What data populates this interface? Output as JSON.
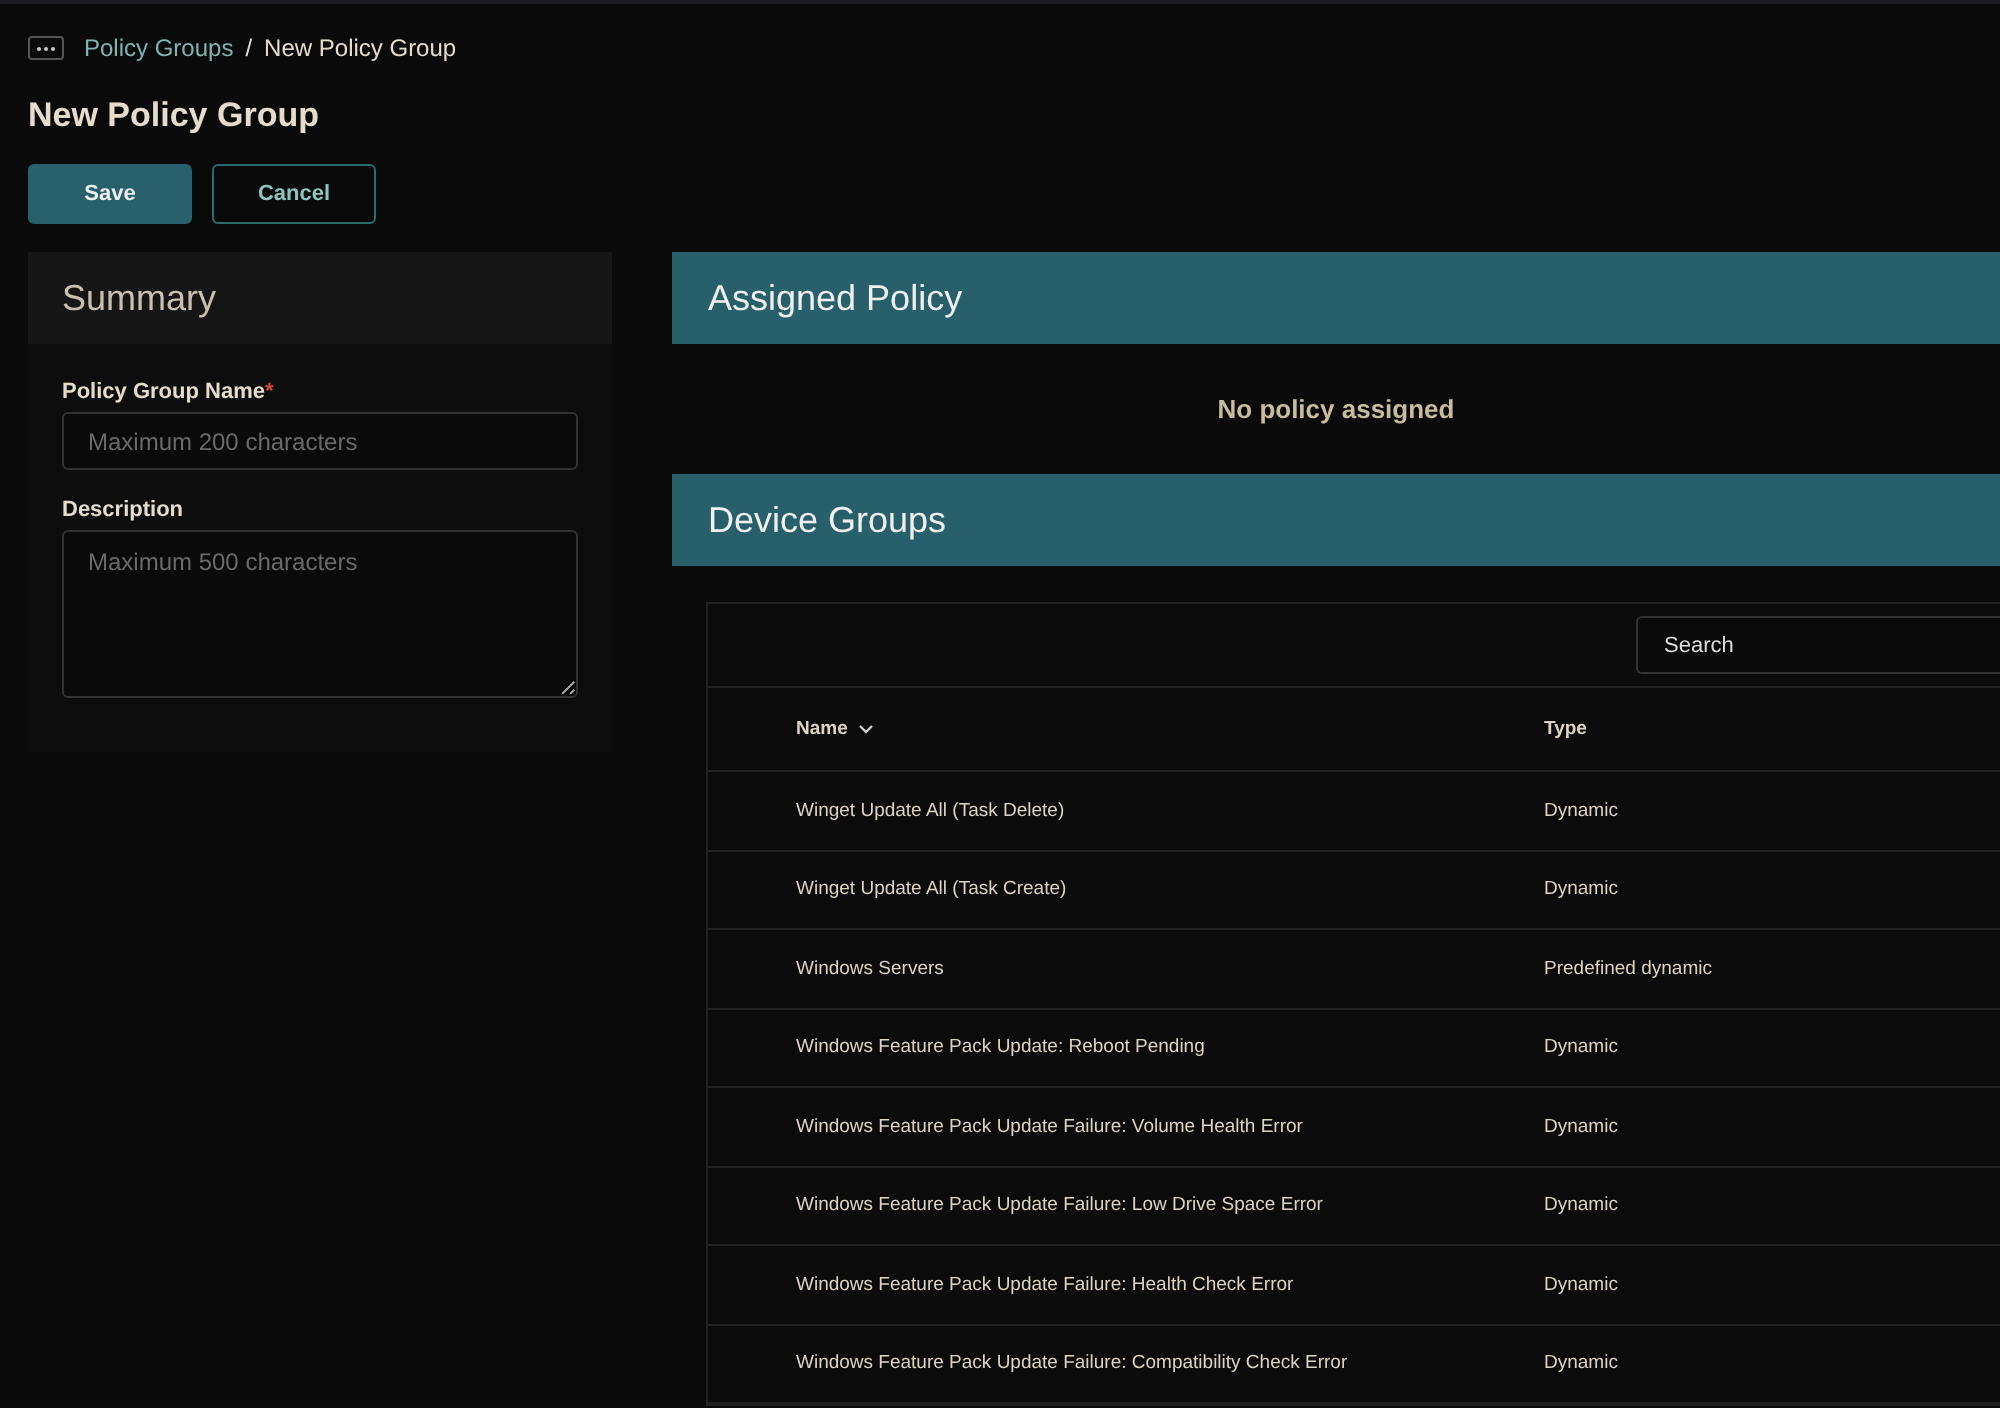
{
  "breadcrumb": {
    "items": [
      "Policy Groups",
      "New Policy Group"
    ],
    "separator": "/"
  },
  "title": "New Policy Group",
  "buttons": [
    {
      "label": "Save",
      "kind": "primary"
    },
    {
      "label": "Cancel",
      "kind": "secondary"
    }
  ],
  "summary": {
    "title": "Summary",
    "fields": [
      {
        "label": "Policy Group Name",
        "required_mark": "*",
        "placeholder": "Maximum 200 characters",
        "kind": "input"
      },
      {
        "label": "Description",
        "placeholder": "Maximum 500 characters",
        "kind": "textarea"
      }
    ]
  },
  "assigned_policy": {
    "title": "Assigned Policy",
    "empty_text": "No policy assigned"
  },
  "device_groups": {
    "title": "Device Groups",
    "search": {
      "placeholder": "Search"
    },
    "columns": [
      "Name",
      "Type"
    ],
    "rows": [
      {
        "name": "Winget Update All (Task Delete)",
        "type": "Dynamic"
      },
      {
        "name": "Winget Update All (Task Create)",
        "type": "Dynamic"
      },
      {
        "name": "Windows Servers",
        "type": "Predefined dynamic"
      },
      {
        "name": "Windows Feature Pack Update: Reboot Pending",
        "type": "Dynamic"
      },
      {
        "name": "Windows Feature Pack Update Failure: Volume Health Error",
        "type": "Dynamic"
      },
      {
        "name": "Windows Feature Pack Update Failure: Low Drive Space Error",
        "type": "Dynamic"
      },
      {
        "name": "Windows Feature Pack Update Failure: Health Check Error",
        "type": "Dynamic"
      },
      {
        "name": "Windows Feature Pack Update Failure: Compatibility Check Error",
        "type": "Dynamic"
      }
    ]
  }
}
